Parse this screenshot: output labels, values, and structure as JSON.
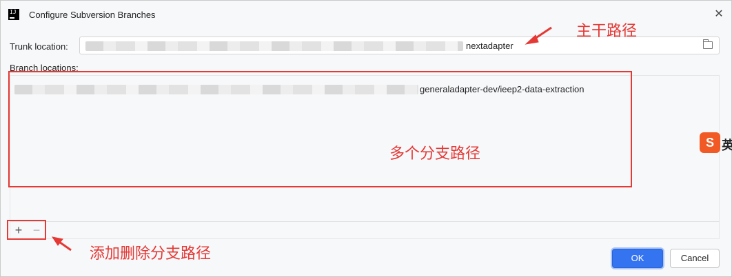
{
  "window": {
    "title": "Configure Subversion Branches",
    "icon_text": "IJ",
    "close_icon": "close-icon"
  },
  "trunk": {
    "label": "Trunk location:",
    "value_suffix": "nextadapter",
    "browse_icon": "folder-icon"
  },
  "branches": {
    "label": "Branch locations:",
    "items": [
      {
        "value_suffix": "generaladapter-dev/ieep2-data-extraction"
      }
    ]
  },
  "toolbar": {
    "add_label": "+",
    "remove_label": "−"
  },
  "buttons": {
    "ok": "OK",
    "cancel": "Cancel"
  },
  "annotations": {
    "trunk_note": "主干路径",
    "branches_note": "多个分支路径",
    "toolbar_note": "添加删除分支路径",
    "color": "#e53935"
  },
  "overlay": {
    "ime_badge": "S",
    "ime_side": "英"
  },
  "colors": {
    "accent": "#3574f0",
    "background": "#f7f8fa"
  }
}
